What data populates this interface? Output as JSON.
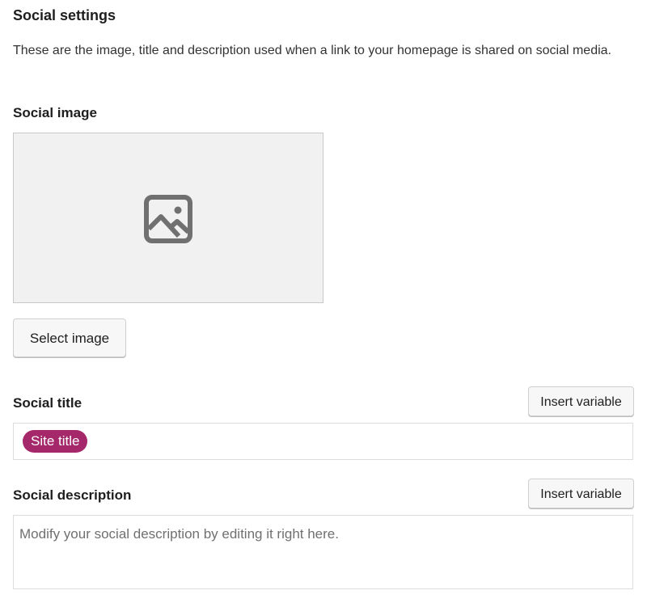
{
  "section": {
    "title": "Social settings",
    "description": "These are the image, title and description used when a link to your homepage is shared on social media."
  },
  "social_image": {
    "label": "Social image",
    "placeholder_icon": "image-placeholder-icon",
    "button_label": "Select image"
  },
  "social_title": {
    "label": "Social title",
    "insert_variable_label": "Insert variable",
    "variables": [
      "Site title"
    ]
  },
  "social_description": {
    "label": "Social description",
    "insert_variable_label": "Insert variable",
    "placeholder": "Modify your social description by editing it right here."
  },
  "colors": {
    "variable_pill": "#a4286a",
    "button_bg": "#f7f7f7",
    "image_bg": "#f1f1f1",
    "icon": "#707070"
  }
}
